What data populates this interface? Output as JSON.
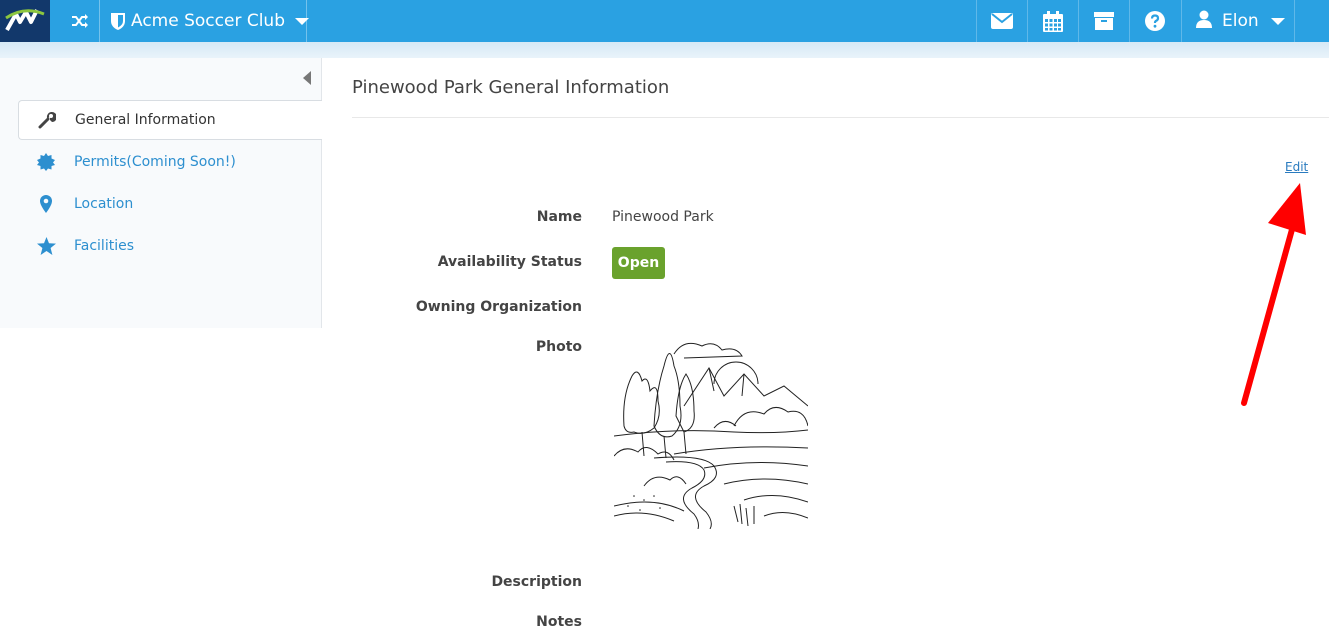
{
  "header": {
    "club_name": "Acme Soccer Club",
    "user_name": "Elon",
    "icons": [
      "shuffle-icon",
      "shield-icon",
      "envelope-icon",
      "calendar-icon",
      "archive-icon",
      "help-icon",
      "user-icon"
    ]
  },
  "sidebar": {
    "items": [
      {
        "label": "General Information",
        "icon": "wrench-icon",
        "active": true
      },
      {
        "label": "Permits(Coming Soon!)",
        "icon": "badge-icon",
        "active": false
      },
      {
        "label": "Location",
        "icon": "map-pin-icon",
        "active": false
      },
      {
        "label": "Facilities",
        "icon": "star-icon",
        "active": false
      }
    ]
  },
  "main": {
    "title": "Pinewood Park General Information",
    "edit_label": "Edit",
    "fields": {
      "name_label": "Name",
      "name_value": "Pinewood Park",
      "status_label": "Availability Status",
      "status_value": "Open",
      "org_label": "Owning Organization",
      "photo_label": "Photo",
      "description_label": "Description",
      "notes_label": "Notes"
    }
  },
  "colors": {
    "topbar": "#2aa1e2",
    "logo_bg": "#12386b",
    "link": "#2d8fcf",
    "badge_open": "#6aa22d",
    "annotation_arrow": "#ff0000"
  }
}
